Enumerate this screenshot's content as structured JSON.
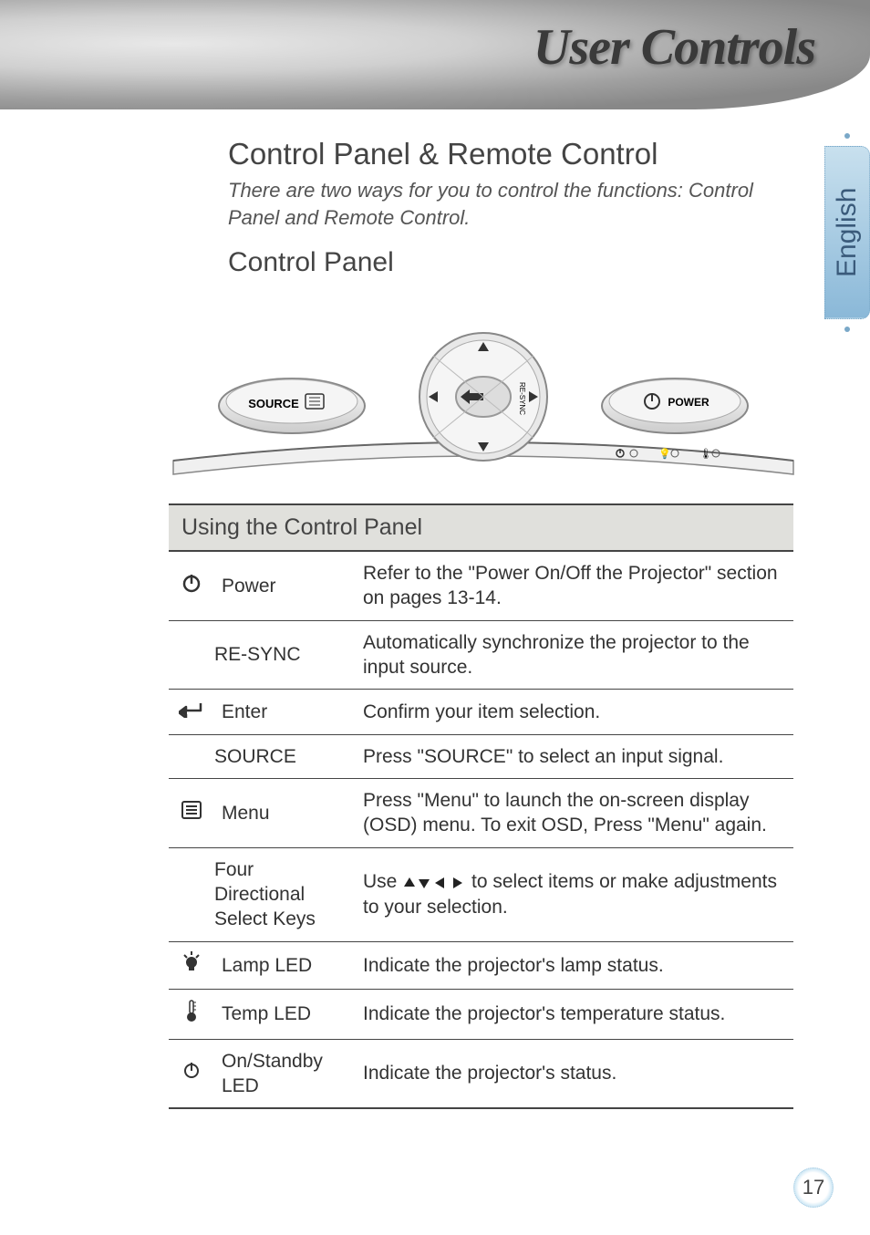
{
  "header": {
    "title": "User Controls"
  },
  "lang_tab": "English",
  "page_number": "17",
  "main": {
    "h2": "Control Panel & Remote Control",
    "intro": "There are two ways for you to control the functions: Control Panel and Remote Control.",
    "h3": "Control Panel"
  },
  "panel_illustration": {
    "source_button": "SOURCE",
    "power_button": "POWER",
    "resync_label": "RE-SYNC"
  },
  "table": {
    "heading": "Using the Control Panel",
    "rows": [
      {
        "icon": "power-icon",
        "label": "Power",
        "desc": "Refer to the \"Power On/Off the Projector\" section on pages 13-14."
      },
      {
        "icon": "",
        "label": "RE-SYNC",
        "desc": "Automatically synchronize the projector to the input source."
      },
      {
        "icon": "enter-icon",
        "label": "Enter",
        "desc": "Confirm your item selection."
      },
      {
        "icon": "",
        "label": "SOURCE",
        "desc": "Press \"SOURCE\" to select an input signal."
      },
      {
        "icon": "menu-icon",
        "label": "Menu",
        "desc": "Press \"Menu\" to launch the on-screen display (OSD) menu. To exit OSD, Press \"Menu\" again."
      },
      {
        "icon": "",
        "label": "Four Directional Select Keys",
        "desc_pre": "Use ",
        "desc_post": " to select items or make adjustments to your selection."
      },
      {
        "icon": "lamp-icon",
        "label": "Lamp LED",
        "desc": "Indicate the projector's lamp status."
      },
      {
        "icon": "temp-icon",
        "label": "Temp LED",
        "desc": "Indicate the projector's temperature status."
      },
      {
        "icon": "standby-icon",
        "label": "On/Standby LED",
        "desc": "Indicate the projector's status."
      }
    ]
  }
}
